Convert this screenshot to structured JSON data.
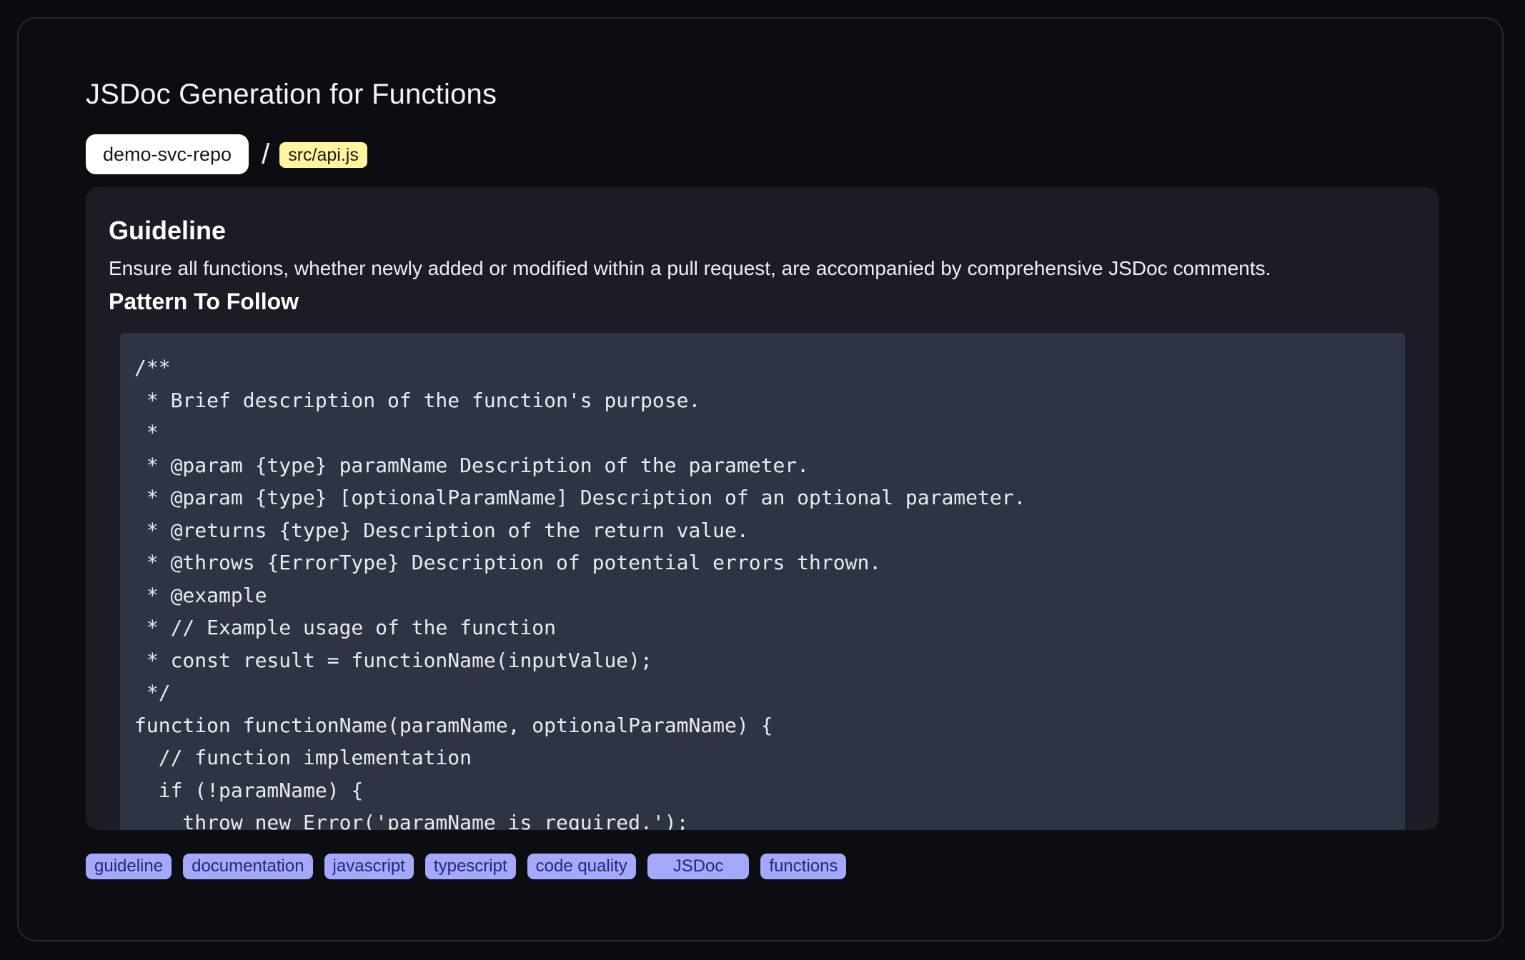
{
  "page": {
    "title": "JSDoc Generation for Functions",
    "breadcrumb": {
      "repo": "demo-svc-repo",
      "separator": "/",
      "file": "src/api.js"
    }
  },
  "guideline": {
    "heading": "Guideline",
    "text": "Ensure all functions, whether newly added or modified within a pull request, are accompanied by comprehensive JSDoc comments.",
    "pattern_heading": "Pattern To Follow",
    "code_lines": [
      "/**",
      " * Brief description of the function's purpose.",
      " *",
      " * @param {type} paramName Description of the parameter.",
      " * @param {type} [optionalParamName] Description of an optional parameter.",
      " * @returns {type} Description of the return value.",
      " * @throws {ErrorType} Description of potential errors thrown.",
      " * @example",
      " * // Example usage of the function",
      " * const result = functionName(inputValue);",
      " */",
      "function functionName(paramName, optionalParamName) {",
      "  // function implementation",
      "  if (!paramName) {",
      "    throw new Error('paramName is required.');"
    ]
  },
  "tags": [
    "guideline",
    "documentation",
    "javascript",
    "typescript",
    "code quality",
    "JSDoc",
    "functions"
  ],
  "colors": {
    "background": "#0b0c10",
    "panel": "#1b1c26",
    "code_background": "#2f3444",
    "file_highlight": "#fff59e",
    "tag_background": "#a5a8ff"
  }
}
